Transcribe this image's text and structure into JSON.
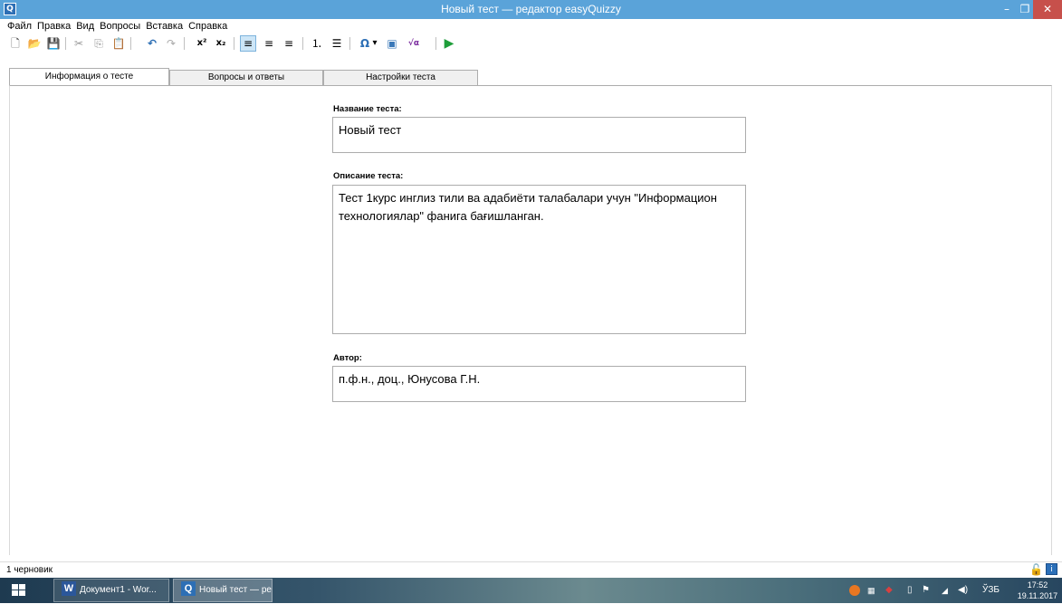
{
  "window": {
    "title": "Новый тест — редактор easyQuizzy",
    "app_icon": "Q",
    "minimize_glyph": "–",
    "maximize_glyph": "❐",
    "close_glyph": "✕"
  },
  "menu": [
    "Файл",
    "Правка",
    "Вид",
    "Вопросы",
    "Вставка",
    "Справка"
  ],
  "toolbar": {
    "new": "🗋",
    "open": "📂",
    "save": "💾",
    "cut": "✂",
    "copy": "⎘",
    "paste": "📋",
    "undo": "↶",
    "redo": "↷",
    "superscript": "x²",
    "subscript": "x₂",
    "align_left": "≡",
    "align_center": "≡",
    "align_right": "≡",
    "numbered_list": "⒈",
    "bullet_list": "☰",
    "symbol": "Ω",
    "symbol_arrow": "▾",
    "image": "▣",
    "formula": "√α",
    "run": "▶"
  },
  "tabs": [
    {
      "label": "Информация о тесте"
    },
    {
      "label": "Вопросы и ответы"
    },
    {
      "label": "Настройки теста"
    }
  ],
  "form": {
    "title_label": "Название теста:",
    "title_value": "Новый тест",
    "description_label": "Описание теста:",
    "description_value": "Тест 1курс инглиз тили ва адабиёти талабалари учун \"Информацион технологиялар\" фанига бағишланган.",
    "author_label": "Автор:",
    "author_value": "п.ф.н., доц., Юнусова Г.Н."
  },
  "status": {
    "text": "1 черновик",
    "lock_icon": "🔓",
    "info_icon": "i"
  },
  "taskbar": {
    "items": [
      {
        "label": "Документ1 - Wor...",
        "icon": "W"
      },
      {
        "label": "Новый тест — ре...",
        "icon": "Q"
      }
    ],
    "language": "ЎЗБ",
    "time": "17:52",
    "date": "19.11.2017"
  },
  "colors": {
    "titlebar": "#5aa3d9",
    "close": "#c7504b",
    "run_green": "#1e9e3a",
    "word_blue": "#2b579a",
    "quizzy_blue": "#2d6fb5"
  }
}
